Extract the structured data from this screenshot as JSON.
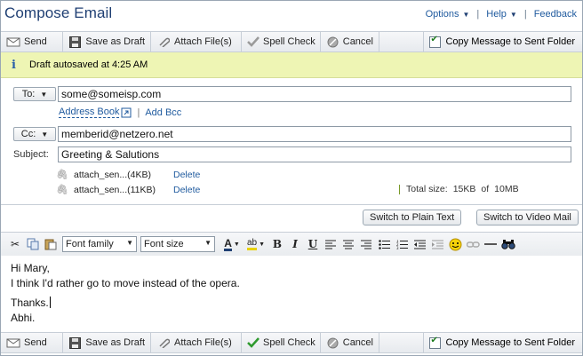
{
  "header": {
    "title": "Compose Email",
    "nav": {
      "options": "Options",
      "help": "Help",
      "feedback": "Feedback"
    }
  },
  "toolbar": {
    "send": "Send",
    "save_draft": "Save as Draft",
    "attach": "Attach File(s)",
    "spell": "Spell Check",
    "cancel": "Cancel",
    "copy_sent": "Copy Message to Sent Folder"
  },
  "autosave": {
    "message": "Draft autosaved at 4:25 AM"
  },
  "fields": {
    "to_label": "To:",
    "to_value": "some@someisp.com",
    "address_book": "Address Book",
    "add_bcc": "Add Bcc",
    "cc_label": "Cc:",
    "cc_value": "memberid@netzero.net",
    "subject_label": "Subject:",
    "subject_value": "Greeting & Salutions"
  },
  "attachments": {
    "items": [
      {
        "name": "attach_sen...(4KB)",
        "delete": "Delete"
      },
      {
        "name": "attach_sen...(11KB)",
        "delete": "Delete"
      }
    ],
    "total_label": "Total size:",
    "total_value": "15KB",
    "of_label": "of",
    "max_value": "10MB"
  },
  "switch": {
    "plain": "Switch to Plain Text",
    "video": "Switch to Video Mail"
  },
  "editor_toolbar": {
    "font_family": "Font family",
    "font_size": "Font size"
  },
  "body": {
    "line1": "Hi Mary,",
    "line2": "I think I'd rather go to move instead of the opera.",
    "line3": "Thanks.",
    "line4": "Abhi."
  },
  "colors": {
    "title": "#1f3f73",
    "link": "#1f5a9e",
    "autosave_bg": "#eef5b4"
  }
}
